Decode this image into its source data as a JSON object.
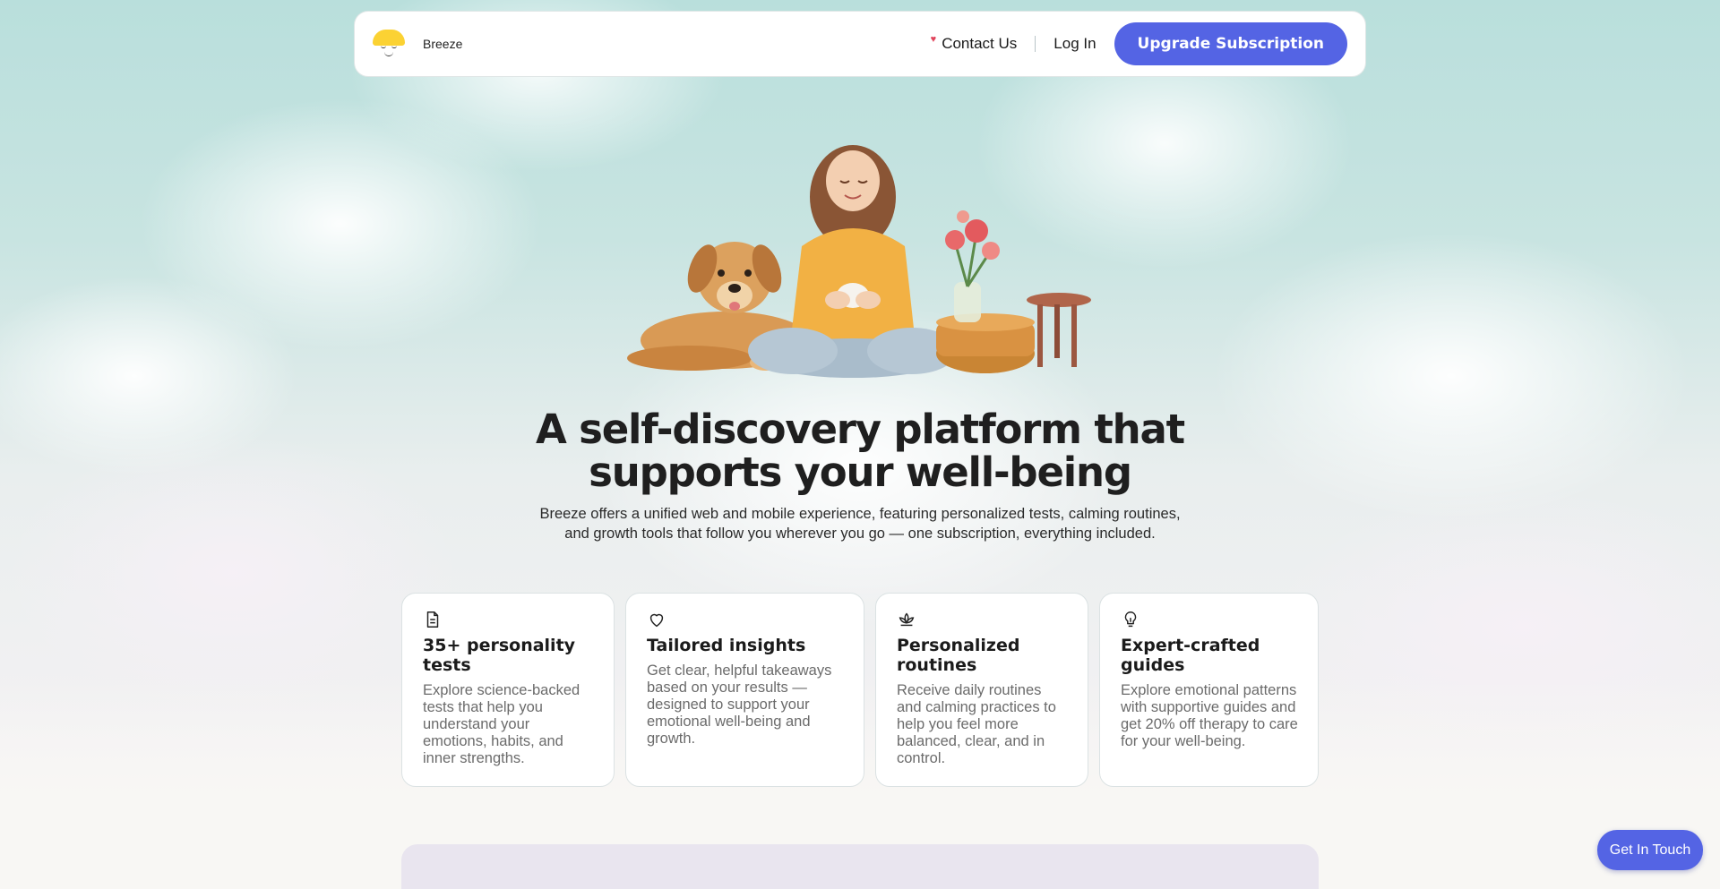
{
  "header": {
    "brand_name": "Breeze",
    "contact_label": "Contact Us",
    "login_label": "Log In",
    "upgrade_label": "Upgrade Subscription"
  },
  "hero": {
    "title": "A self-discovery platform that supports your well-being",
    "subtitle": "Breeze offers a unified web and mobile experience, featuring personalized tests, calming routines, and growth tools that follow you wherever you go — one subscription, everything included."
  },
  "features": [
    {
      "icon": "document-icon",
      "title": "35+ personality tests",
      "description": "Explore science-backed tests that help you understand your emotions, habits, and inner strengths."
    },
    {
      "icon": "heart-icon",
      "title": "Tailored insights",
      "description": "Get clear, helpful takeaways based on your results — designed to support your emotional well-being and growth."
    },
    {
      "icon": "lotus-icon",
      "title": "Personalized routines",
      "description": "Receive daily routines and calming practices to help you feel more balanced, clear, and in control."
    },
    {
      "icon": "lightbulb-icon",
      "title": "Expert-crafted guides",
      "description": "Explore emotional patterns with supportive guides and get 20% off therapy to care for your well-being."
    }
  ],
  "floating": {
    "get_in_touch_label": "Get In Touch"
  },
  "colors": {
    "accent": "#5464e4",
    "logo_yellow": "#fbd233",
    "heading": "#1f1f1f",
    "body_muted": "#6b6b6b"
  }
}
